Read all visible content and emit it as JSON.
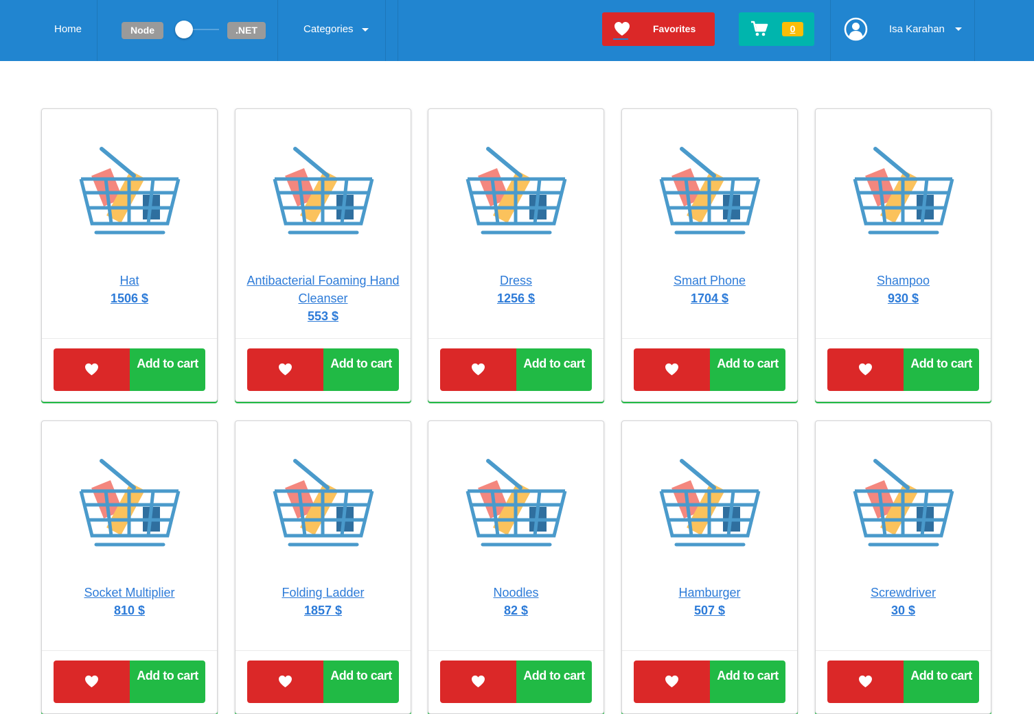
{
  "nav": {
    "home": "Home",
    "runtime_toggle": {
      "left": "Node",
      "right": ".NET"
    },
    "categories": "Categories",
    "favorites": "Favorites",
    "cart_count": "0",
    "user_name": "Isa Karahan"
  },
  "colors": {
    "navbar": "#2185d0",
    "favorites": "#db2828",
    "cart": "#00b5ad",
    "cart_badge": "#fbbd08",
    "like_button": "#db2828",
    "add_button": "#21ba45",
    "link": "#2d7bd8"
  },
  "icons": {
    "favorites": "heart-icon",
    "cart": "shopping-cart-icon",
    "user": "user-circle-icon",
    "product_image": "shopping-basket-icon",
    "like": "heart-icon",
    "dropdown": "caret-down-icon"
  },
  "buttons": {
    "add_to_cart": "Add to cart"
  },
  "products": [
    {
      "name": "Hat",
      "price": "1506 $"
    },
    {
      "name": "Antibacterial Foaming Hand Cleanser",
      "price": "553 $"
    },
    {
      "name": "Dress",
      "price": "1256 $"
    },
    {
      "name": "Smart Phone",
      "price": "1704 $"
    },
    {
      "name": "Shampoo",
      "price": "930 $"
    },
    {
      "name": "Socket Multiplier",
      "price": "810 $"
    },
    {
      "name": "Folding Ladder",
      "price": "1857 $"
    },
    {
      "name": "Noodles",
      "price": "82 $"
    },
    {
      "name": "Hamburger",
      "price": "507 $"
    },
    {
      "name": "Screwdriver",
      "price": "30 $"
    }
  ]
}
